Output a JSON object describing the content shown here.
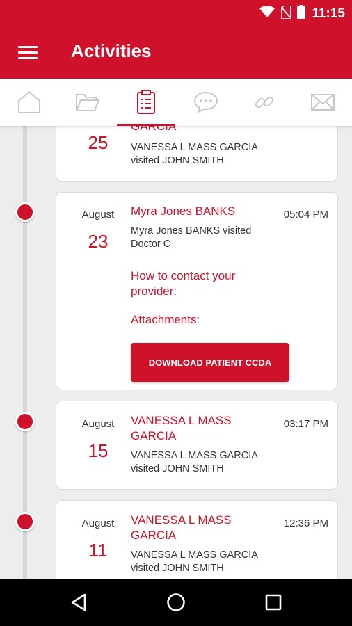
{
  "status_bar": {
    "time": "11:15",
    "icons": [
      "wifi-icon",
      "no-sim-icon",
      "battery-icon"
    ]
  },
  "app_bar": {
    "title": "Activities",
    "menu_icon": "menu-icon"
  },
  "tabs": [
    {
      "icon": "home-icon",
      "active": false
    },
    {
      "icon": "folder-icon",
      "active": false
    },
    {
      "icon": "clipboard-icon",
      "active": true
    },
    {
      "icon": "chat-icon",
      "active": false
    },
    {
      "icon": "link-icon",
      "active": false
    },
    {
      "icon": "mail-icon",
      "active": false
    }
  ],
  "activities": [
    {
      "title_partial": "GARCIA",
      "day": "25",
      "description": "VANESSA L MASS GARCIA visited  JOHN SMITH"
    },
    {
      "month": "August",
      "day": "23",
      "title": "Myra Jones BANKS",
      "time": "05:04 PM",
      "description": "Myra Jones BANKS visited Doctor C",
      "contact_label": "How to contact your provider:",
      "attachments_label": "Attachments:",
      "button_label": "DOWNLOAD PATIENT CCDA"
    },
    {
      "month": "August",
      "day": "15",
      "title": "VANESSA L MASS GARCIA",
      "time": "03:17 PM",
      "description": "VANESSA L MASS GARCIA visited  JOHN SMITH"
    },
    {
      "month": "August",
      "day": "11",
      "title": "VANESSA L MASS GARCIA",
      "time": "12:36 PM",
      "description": "VANESSA L MASS GARCIA visited  JOHN SMITH"
    }
  ],
  "nav_bar": {
    "buttons": [
      "back-icon",
      "home-circle-icon",
      "recents-icon"
    ]
  },
  "colors": {
    "accent": "#d0112b",
    "background": "#ededed",
    "tab_icon": "#c8c8c8"
  }
}
